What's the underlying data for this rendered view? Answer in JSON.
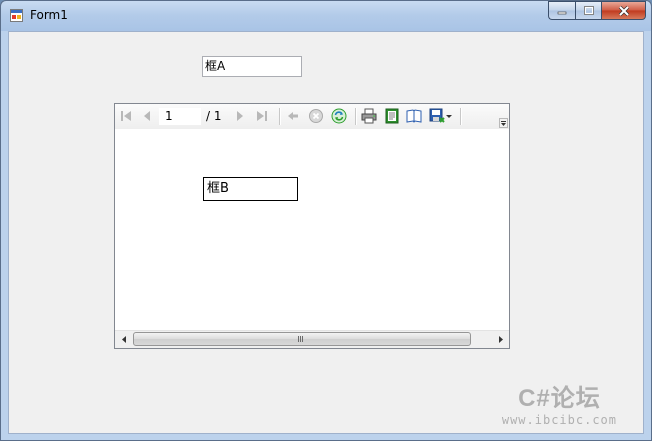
{
  "window": {
    "title": "Form1",
    "controls": {
      "minimize": "minimize-icon",
      "maximize": "maximize-icon",
      "close": "close-icon"
    }
  },
  "form": {
    "textbox_a": {
      "value": "框A"
    }
  },
  "report_viewer": {
    "toolbar": {
      "current_page": "1",
      "total_pages": "/ 1",
      "icons": [
        "first-page-icon",
        "previous-page-icon",
        "next-page-icon",
        "last-page-icon",
        "back-icon",
        "stop-icon",
        "refresh-icon",
        "print-icon",
        "print-layout-icon",
        "page-setup-icon",
        "export-icon",
        "export-dropdown-icon"
      ]
    },
    "content": {
      "textbox_b": {
        "value": "框B"
      }
    },
    "scrollbar": {
      "grip": "III"
    }
  },
  "watermark": {
    "main": "C#论坛",
    "sub": "www.ibcibc.com"
  },
  "colors": {
    "title_bar": "#b3cbe9",
    "close_button": "#c0391e",
    "client_background": "#f0f0f0",
    "refresh_icon": "#2e9e2e",
    "export_icon": "#2d5fb0"
  }
}
